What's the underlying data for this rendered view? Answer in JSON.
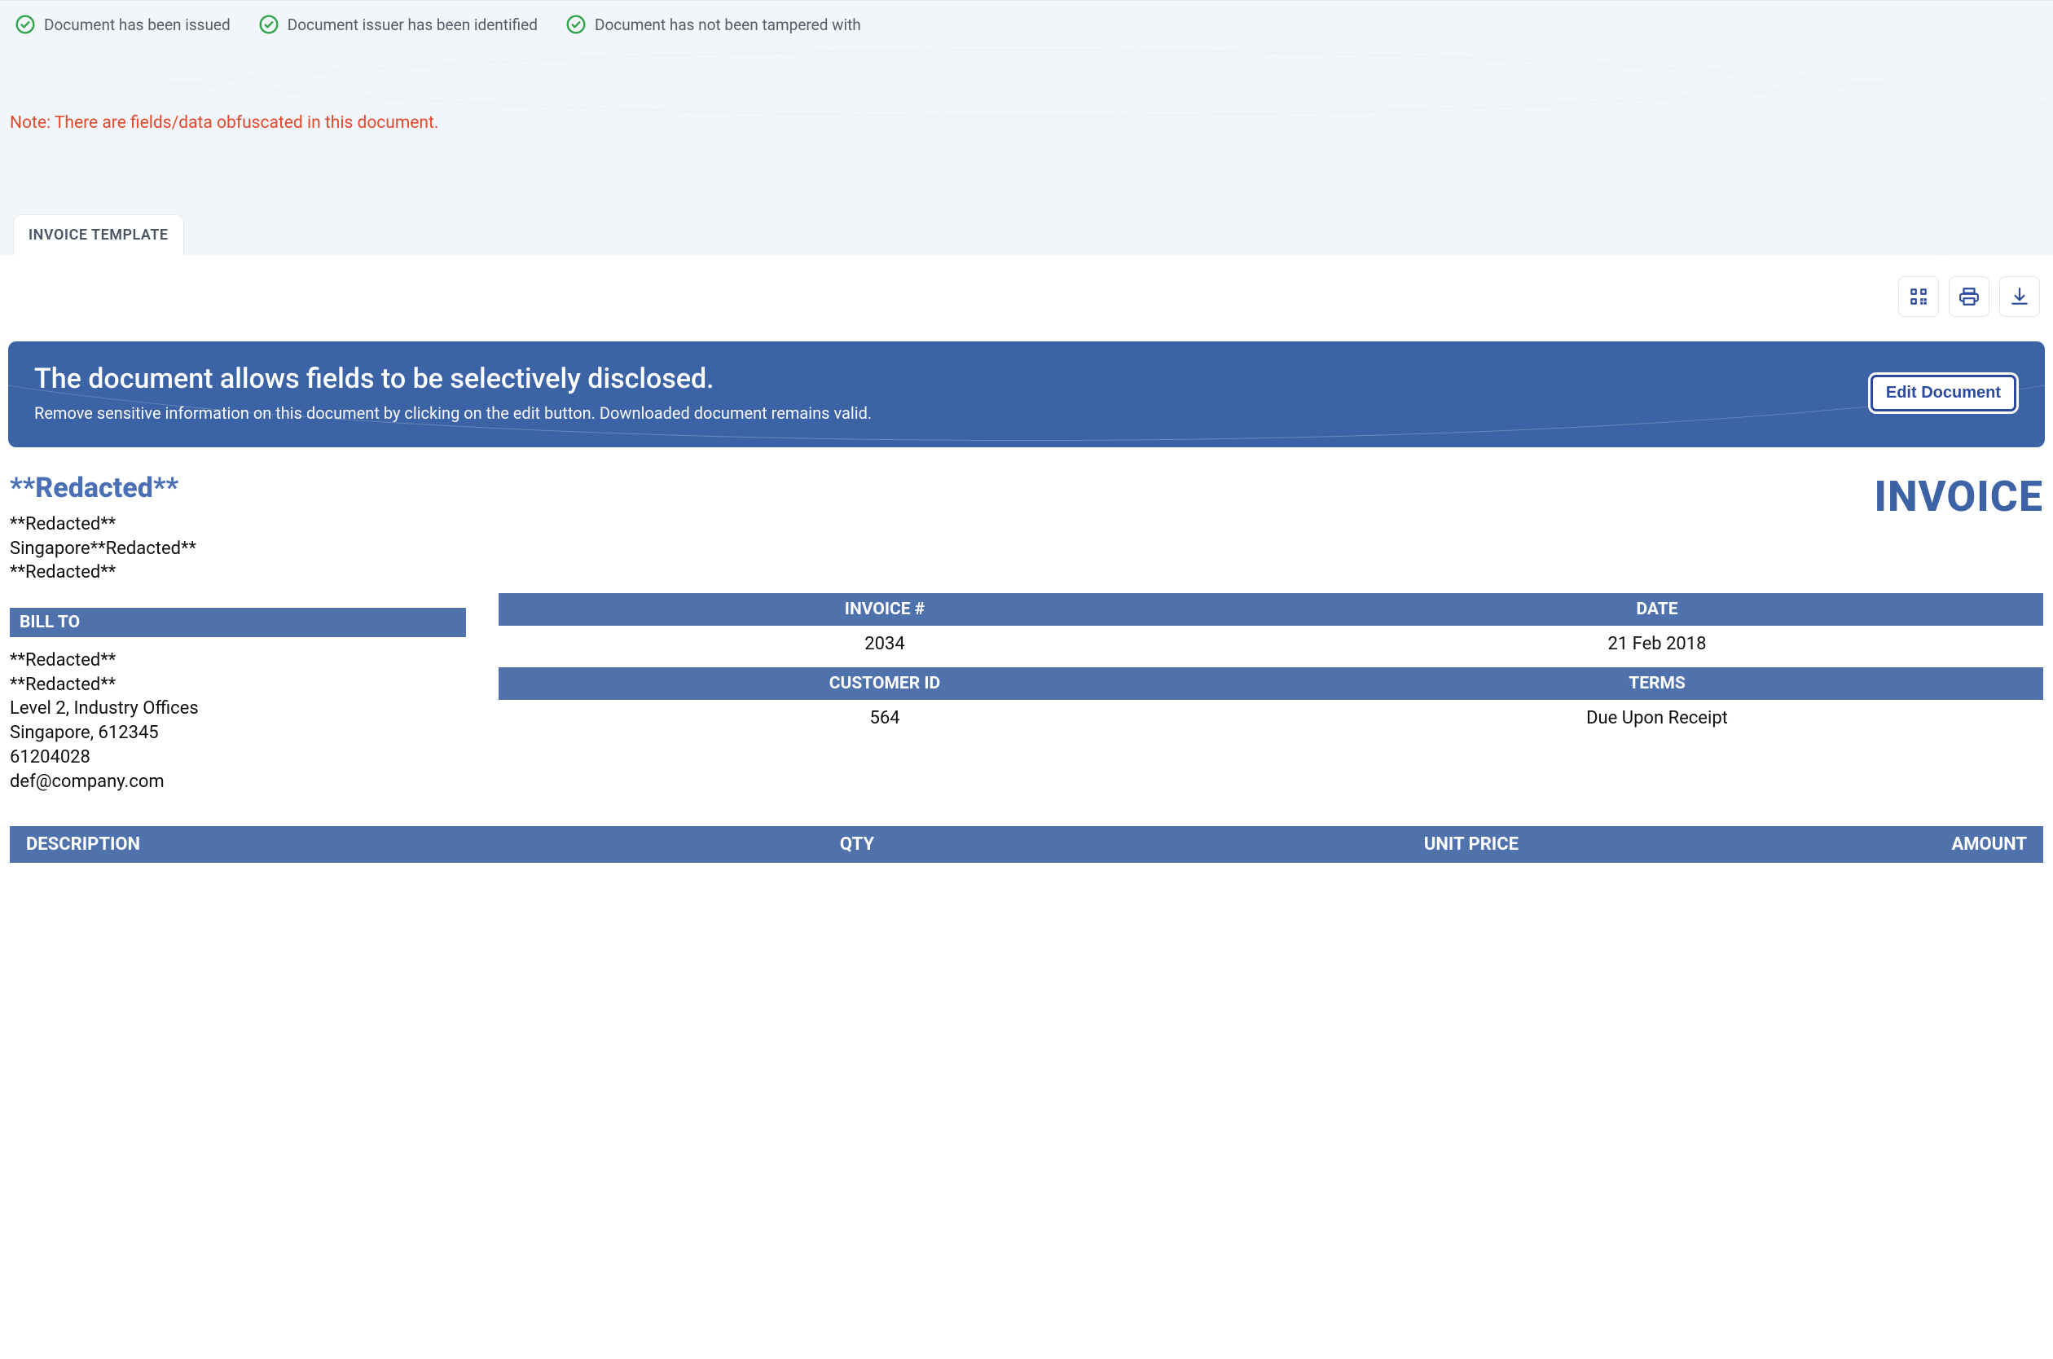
{
  "verification": {
    "items": [
      {
        "label": "Document has been issued"
      },
      {
        "label": "Document issuer has been identified"
      },
      {
        "label": "Document has not been tampered with"
      }
    ]
  },
  "note": "Note: There are fields/data obfuscated in this document.",
  "tab": {
    "label": "INVOICE TEMPLATE"
  },
  "actions": {
    "qr": "QR code",
    "print": "Print",
    "download": "Download"
  },
  "banner": {
    "title": "The document allows fields to be selectively disclosed.",
    "subtitle": "Remove sensitive information on this document by clicking on the edit button. Downloaded document remains valid.",
    "edit_label": "Edit Document"
  },
  "sender": {
    "name": "**Redacted**",
    "line1": "**Redacted**",
    "line2": "Singapore**Redacted**",
    "line3": "**Redacted**"
  },
  "invoice_word": "INVOICE",
  "meta": {
    "h_invoice": "INVOICE #",
    "h_date": "DATE",
    "invoice_no": "2034",
    "date": "21 Feb 2018",
    "h_customer": "CUSTOMER ID",
    "h_terms": "TERMS",
    "customer_id": "564",
    "terms": "Due Upon Receipt"
  },
  "bill_to": {
    "header": "BILL TO",
    "line1": "**Redacted**",
    "line2": "**Redacted**",
    "line3": "Level 2, Industry Offices",
    "line4": "Singapore, 612345",
    "line5": "61204028",
    "line6": "def@company.com"
  },
  "items_head": {
    "desc": "DESCRIPTION",
    "qty": "QTY",
    "price": "UNIT PRICE",
    "amount": "AMOUNT"
  }
}
